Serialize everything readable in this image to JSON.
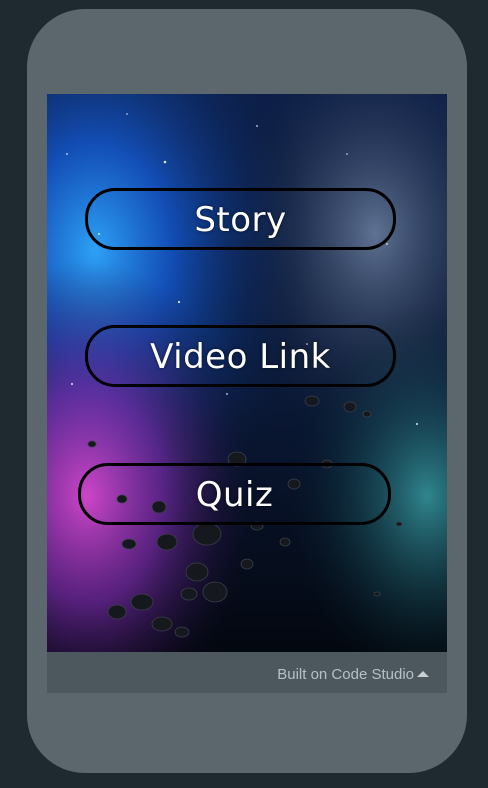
{
  "app": {
    "buttons": {
      "story": "Story",
      "video": "Video Link",
      "quiz": "Quiz"
    }
  },
  "footer": {
    "label": "Built on Code Studio",
    "icon": "caret-up-icon"
  },
  "colors": {
    "page_background": "#1f2a30",
    "phone_frame": "#5b676d",
    "footer_bar": "#4d585e",
    "button_text": "#ffffff",
    "button_border": "#000000"
  }
}
